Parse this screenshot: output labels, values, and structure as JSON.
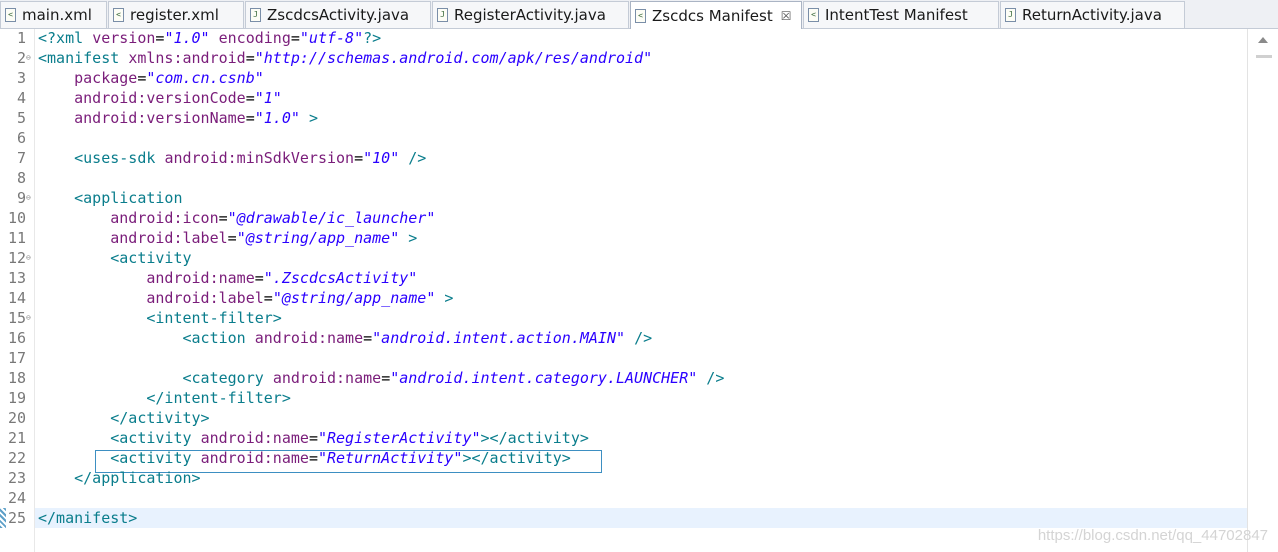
{
  "tabs": [
    {
      "label": "main.xml",
      "type": "xml",
      "active": false
    },
    {
      "label": "register.xml",
      "type": "xml",
      "active": false
    },
    {
      "label": "ZscdcsActivity.java",
      "type": "java",
      "active": false
    },
    {
      "label": "RegisterActivity.java",
      "type": "java",
      "active": false
    },
    {
      "label": "Zscdcs Manifest",
      "type": "manifest",
      "active": true,
      "close_glyph": "☒"
    },
    {
      "label": "IntentTest Manifest",
      "type": "manifest",
      "active": false
    },
    {
      "label": "ReturnActivity.java",
      "type": "java",
      "active": false
    }
  ],
  "editor": {
    "line_numbers": [
      "1",
      "2",
      "3",
      "4",
      "5",
      "6",
      "7",
      "8",
      "9",
      "10",
      "11",
      "12",
      "13",
      "14",
      "15",
      "16",
      "17",
      "18",
      "19",
      "20",
      "21",
      "22",
      "23",
      "24",
      "25"
    ],
    "current_line": "25",
    "folded_lines": [
      "2",
      "9",
      "12",
      "15"
    ]
  },
  "watermark": "https://blog.csdn.net/qq_44702847",
  "colors": {
    "tag": "#0a7d8c",
    "attr": "#7a1d7a",
    "value": "#2a00ff",
    "current_line": "#e8f2fe",
    "selection_border": "#3d8fc2"
  }
}
